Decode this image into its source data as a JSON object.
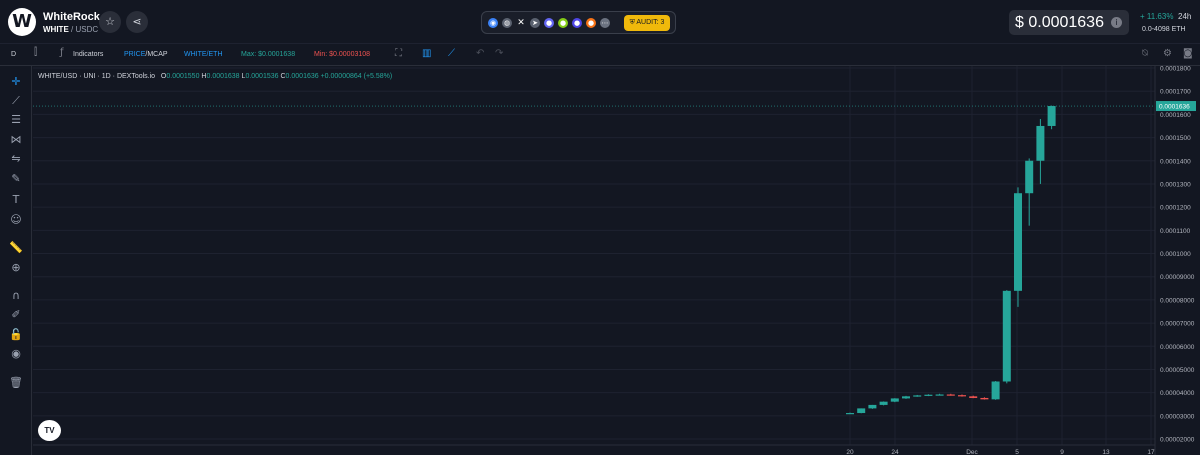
{
  "header": {
    "logo_letter": "W",
    "token_name": "WhiteRock",
    "base": "WHITE",
    "quote_suffix": " / USDC",
    "star_icon": "star-icon",
    "share_icon": "share-icon",
    "audit_label": "AUDIT: 3",
    "price": "$ 0.0001636",
    "change": "+ 11.63%",
    "period": "24h",
    "liquidity": "0.0-4098  ETH"
  },
  "toolbar": {
    "interval": "D",
    "indicators": "Indicators",
    "price_label": "PRICE",
    "mcap_label": "/MCAP",
    "pair_label": "WHITE/ETH",
    "max_label": "Max: $0.0001638",
    "min_label": "Min: $0.00003108"
  },
  "legend": {
    "symbol": "WHITE/USD · UNI · 1D · DEXTools.io",
    "o_key": "O",
    "o_val": "0.0001550",
    "h_key": "H",
    "h_val": "0.0001638",
    "l_key": "L",
    "l_val": "0.0001536",
    "c_key": "C",
    "c_val": "0.0001636",
    "change": "+0.00000864 (+5.58%)"
  },
  "colors": {
    "up": "#26a69a",
    "down": "#ef5350",
    "background": "#131722",
    "grid": "#1e2230"
  },
  "chart_data": {
    "type": "candlestick",
    "title": "",
    "y_ticks": [
      "0.0001800",
      "0.0001700",
      "0.0001600",
      "0.0001500",
      "0.0001400",
      "0.0001300",
      "0.0001200",
      "0.0001100",
      "0.0001000",
      "0.00009000",
      "0.00008000",
      "0.00007000",
      "0.00006000",
      "0.00005000",
      "0.00004000",
      "0.00003000",
      "0.00002000"
    ],
    "ylim": [
      2e-05,
      0.00018
    ],
    "x_ticks": [
      "20",
      "24",
      "Dec",
      "5",
      "9",
      "13",
      "17"
    ],
    "last_price_label": "0.0001636",
    "candles": [
      {
        "o": 3.11e-05,
        "h": 3.14e-05,
        "l": 3.09e-05,
        "c": 3.12e-05
      },
      {
        "o": 3.12e-05,
        "h": 3.32e-05,
        "l": 3.11e-05,
        "c": 3.32e-05
      },
      {
        "o": 3.32e-05,
        "h": 3.47e-05,
        "l": 3.3e-05,
        "c": 3.47e-05
      },
      {
        "o": 3.47e-05,
        "h": 3.62e-05,
        "l": 3.45e-05,
        "c": 3.61e-05
      },
      {
        "o": 3.61e-05,
        "h": 3.76e-05,
        "l": 3.59e-05,
        "c": 3.75e-05
      },
      {
        "o": 3.75e-05,
        "h": 3.86e-05,
        "l": 3.73e-05,
        "c": 3.84e-05
      },
      {
        "o": 3.84e-05,
        "h": 3.9e-05,
        "l": 3.82e-05,
        "c": 3.88e-05
      },
      {
        "o": 3.88e-05,
        "h": 3.93e-05,
        "l": 3.85e-05,
        "c": 3.91e-05
      },
      {
        "o": 3.91e-05,
        "h": 3.95e-05,
        "l": 3.88e-05,
        "c": 3.92e-05
      },
      {
        "o": 3.92e-05,
        "h": 3.95e-05,
        "l": 3.87e-05,
        "c": 3.89e-05
      },
      {
        "o": 3.89e-05,
        "h": 3.92e-05,
        "l": 3.83e-05,
        "c": 3.84e-05
      },
      {
        "o": 3.84e-05,
        "h": 3.87e-05,
        "l": 3.76e-05,
        "c": 3.77e-05
      },
      {
        "o": 3.77e-05,
        "h": 3.8e-05,
        "l": 3.7e-05,
        "c": 3.71e-05
      },
      {
        "o": 3.71e-05,
        "h": 4.5e-05,
        "l": 3.69e-05,
        "c": 4.48e-05
      },
      {
        "o": 4.48e-05,
        "h": 8.42e-05,
        "l": 4.4e-05,
        "c": 8.39e-05
      },
      {
        "o": 8.39e-05,
        "h": 0.0001285,
        "l": 7.7e-05,
        "c": 0.000126
      },
      {
        "o": 0.000126,
        "h": 0.000141,
        "l": 0.000112,
        "c": 0.00014
      },
      {
        "o": 0.00014,
        "h": 0.000158,
        "l": 0.00013,
        "c": 0.000155
      },
      {
        "o": 0.000155,
        "h": 0.0001638,
        "l": 0.0001536,
        "c": 0.0001636
      }
    ]
  }
}
